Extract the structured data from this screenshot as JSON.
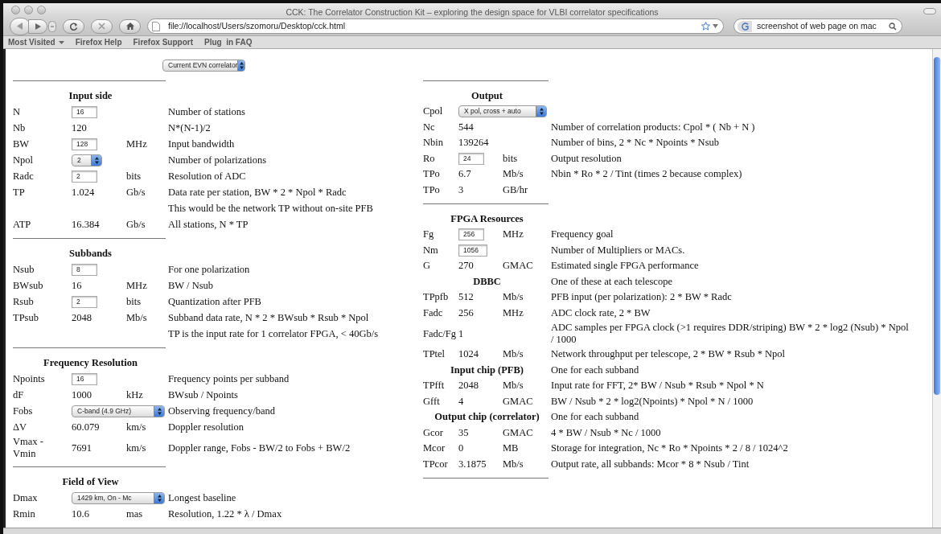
{
  "window": {
    "title": "CCK: The Correlator Construction Kit – exploring the design space for VLBI correlator specifications"
  },
  "toolbar": {
    "address": "file://localhost/Users/szomoru/Desktop/cck.html",
    "search": "screenshot of web page on mac"
  },
  "bookmarks": [
    {
      "label": "Most Visited",
      "has_menu": true
    },
    {
      "label": "Firefox Help",
      "has_menu": false
    },
    {
      "label": "Firefox Support",
      "has_menu": false
    },
    {
      "label": "Plug  in FAQ",
      "has_menu": false
    }
  ],
  "preset": "Current EVN correlator",
  "left": [
    {
      "title": "Input side",
      "rows": [
        {
          "kind": "input",
          "label": "N",
          "value": "16",
          "description": "Number of stations"
        },
        {
          "kind": "value",
          "label": "Nb",
          "value": "120",
          "description": "N*(N-1)/2"
        },
        {
          "kind": "input",
          "label": "BW",
          "value": "128",
          "unit": "MHz",
          "description": "Input bandwidth"
        },
        {
          "kind": "select",
          "label": "Npol",
          "value": "2",
          "description": "Number of polarizations"
        },
        {
          "kind": "input",
          "label": "Radc",
          "value": "2",
          "unit": "bits",
          "description": "Resolution of ADC"
        },
        {
          "kind": "value",
          "label": "TP",
          "value": "1.024",
          "unit": "Gb/s",
          "description": "Data rate per station, BW * 2 * Npol * Radc"
        },
        {
          "kind": "note",
          "description": "This would be the network TP without on-site PFB"
        },
        {
          "kind": "value",
          "label": "ATP",
          "value": "16.384",
          "unit": "Gb/s",
          "description": "All stations, N * TP"
        }
      ]
    },
    {
      "title": "Subbands",
      "rows": [
        {
          "kind": "input",
          "label": "Nsub",
          "value": "8",
          "description": "For one polarization"
        },
        {
          "kind": "value",
          "label": "BWsub",
          "value": "16",
          "unit": "MHz",
          "description": "BW / Nsub"
        },
        {
          "kind": "input",
          "label": "Rsub",
          "value": "2",
          "unit": "bits",
          "description": "Quantization after PFB"
        },
        {
          "kind": "value",
          "label": "TPsub",
          "value": "2048",
          "unit": "Mb/s",
          "description": "Subband data rate, N * 2 * BWsub * Rsub * Npol"
        },
        {
          "kind": "note",
          "description": "TP is the input rate for 1 correlator FPGA, < 40Gb/s"
        }
      ]
    },
    {
      "title": "Frequency Resolution",
      "rows": [
        {
          "kind": "input",
          "label": "Npoints",
          "value": "16",
          "description": "Frequency points per subband"
        },
        {
          "kind": "value",
          "label": "dF",
          "value": "1000",
          "unit": "kHz",
          "description": "BWsub / Npoints"
        },
        {
          "kind": "select",
          "label": "Fobs",
          "value": "C-band (4.9 GHz)",
          "description": "Observing frequency/band"
        },
        {
          "kind": "value",
          "label": "ΔV",
          "value": "60.079",
          "unit": "km/s",
          "description": "Doppler resolution"
        },
        {
          "kind": "value",
          "label": "Vmax - Vmin",
          "value": "7691",
          "unit": "km/s",
          "description": "Doppler range, Fobs - BW/2 to Fobs + BW/2"
        }
      ]
    },
    {
      "title": "Field of View",
      "rows": [
        {
          "kind": "select",
          "label": "Dmax",
          "value": "1429 km, On - Mc",
          "description": "Longest baseline"
        },
        {
          "kind": "value",
          "label": "Rmin",
          "value": "10.6",
          "unit": "mas",
          "description": "Resolution, 1.22 * λ / Dmax"
        }
      ]
    }
  ],
  "right": [
    {
      "title": "Output",
      "rows": [
        {
          "kind": "select",
          "label": "Cpol",
          "value": "X pol, cross + auto"
        },
        {
          "kind": "value",
          "label": "Nc",
          "value": "544",
          "description": "Number of correlation products: Cpol * ( Nb + N )"
        },
        {
          "kind": "value",
          "label": "Nbin",
          "value": "139264",
          "description": "Number of bins, 2 * Nc * Npoints * Nsub"
        },
        {
          "kind": "input",
          "label": "Ro",
          "value": "24",
          "unit": "bits",
          "description": "Output resolution"
        },
        {
          "kind": "value",
          "label": "TPo",
          "value": "6.7",
          "unit": "Mb/s",
          "description": "Nbin * Ro * 2 / Tint (times 2 because complex)"
        },
        {
          "kind": "value",
          "label": "TPo",
          "value": "3",
          "unit": "GB/hr"
        }
      ]
    },
    {
      "title": "FPGA Resources",
      "rows": [
        {
          "kind": "input",
          "label": "Fg",
          "value": "256",
          "unit": "MHz",
          "description": "Frequency goal"
        },
        {
          "kind": "input",
          "label": "Nm",
          "value": "1056",
          "description": "Number of Multipliers or MACs."
        },
        {
          "kind": "value",
          "label": "G",
          "value": "270",
          "unit": "GMAC",
          "description": "Estimated single FPGA performance"
        },
        {
          "kind": "heading",
          "label": "DBBC",
          "description": "One of these at each telescope"
        },
        {
          "kind": "value",
          "label": "TPpfb",
          "value": "512",
          "unit": "Mb/s",
          "description": "PFB input (per polarization): 2 * BW * Radc"
        },
        {
          "kind": "value",
          "label": "Fadc",
          "value": "256",
          "unit": "MHz",
          "description": "ADC clock rate, 2 * BW"
        },
        {
          "kind": "value",
          "label": "Fadc/Fg",
          "value": "1",
          "description": "ADC samples per FPGA clock (>1 requires DDR/striping) BW * 2 * log2 (Nsub) * Npol / 1000"
        },
        {
          "kind": "value",
          "label": "TPtel",
          "value": "1024",
          "unit": "Mb/s",
          "description": "Network throughput per telescope, 2 * BW * Rsub * Npol"
        },
        {
          "kind": "heading",
          "label": "Input chip (PFB)",
          "description": "One for each subband"
        },
        {
          "kind": "value",
          "label": "TPfft",
          "value": "2048",
          "unit": "Mb/s",
          "description": "Input rate for FFT, 2* BW / Nsub * Rsub * Npol * N"
        },
        {
          "kind": "value",
          "label": "Gfft",
          "value": "4",
          "unit": "GMAC",
          "description": "BW / Nsub * 2 * log2(Npoints) * Npol * N / 1000"
        },
        {
          "kind": "heading",
          "label": "Output chip (correlator)",
          "description": "One for each subband"
        },
        {
          "kind": "value",
          "label": "Gcor",
          "value": "35",
          "unit": "GMAC",
          "description": "4 * BW / Nsub * Nc / 1000"
        },
        {
          "kind": "value",
          "label": "Mcor",
          "value": "0",
          "unit": "MB",
          "description": "Storage for integration, Nc * Ro * Npoints * 2 / 8 / 1024^2"
        },
        {
          "kind": "value",
          "label": "TPcor",
          "value": "3.1875",
          "unit": "Mb/s",
          "description": "Output rate, all subbands: Mcor * 8 * Nsub / Tint"
        }
      ]
    }
  ]
}
